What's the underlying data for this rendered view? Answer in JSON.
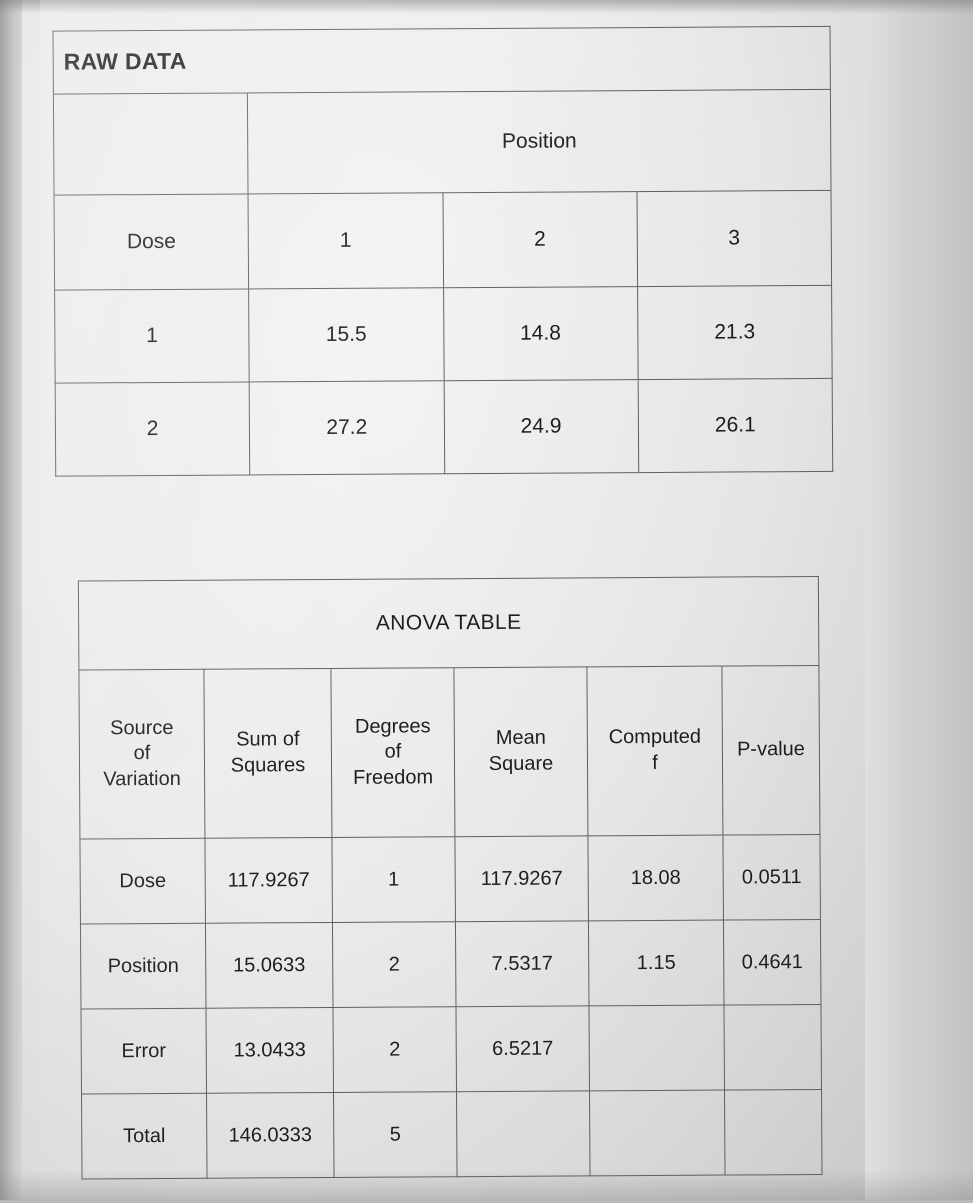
{
  "raw_data": {
    "title": "RAW DATA",
    "position_header": "Position",
    "dose_header": "Dose",
    "position_levels": [
      "1",
      "2",
      "3"
    ],
    "rows": [
      {
        "dose": "1",
        "values": [
          "15.5",
          "14.8",
          "21.3"
        ]
      },
      {
        "dose": "2",
        "values": [
          "27.2",
          "24.9",
          "26.1"
        ]
      }
    ]
  },
  "anova": {
    "title": "ANOVA TABLE",
    "headers": [
      "Source\nof\nVariation",
      "Sum of\nSquares",
      "Degrees\nof\nFreedom",
      "Mean\nSquare",
      "Computed\nf",
      "P-value"
    ],
    "rows": [
      {
        "source": "Dose",
        "sum_of_squares": "117.9267",
        "degrees_of_freedom": "1",
        "mean_square": "117.9267",
        "computed_f": "18.08",
        "p_value": "0.0511"
      },
      {
        "source": "Position",
        "sum_of_squares": "15.0633",
        "degrees_of_freedom": "2",
        "mean_square": "7.5317",
        "computed_f": "1.15",
        "p_value": "0.4641"
      },
      {
        "source": "Error",
        "sum_of_squares": "13.0433",
        "degrees_of_freedom": "2",
        "mean_square": "6.5217",
        "computed_f": "",
        "p_value": ""
      },
      {
        "source": "Total",
        "sum_of_squares": "146.0333",
        "degrees_of_freedom": "5",
        "mean_square": "",
        "computed_f": "",
        "p_value": ""
      }
    ]
  }
}
